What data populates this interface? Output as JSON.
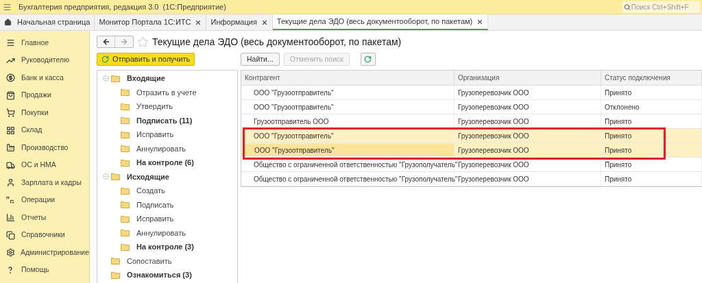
{
  "app_title": "Бухгалтерия предприятия, редакция 3.0  (1С:Предприятие)",
  "search": {
    "placeholder": "Поиск Ctrl+Shift+F"
  },
  "tabs": [
    {
      "label": "Начальная страница",
      "kind": "home",
      "selected": false
    },
    {
      "label": "Монитор Портала 1С:ИТС",
      "kind": "doc",
      "selected": false
    },
    {
      "label": "Информация",
      "kind": "doc",
      "selected": false
    },
    {
      "label": "Текущие дела ЭДО (весь документооборот, по пакетам)",
      "kind": "doc",
      "selected": true
    }
  ],
  "sidebar": {
    "items": [
      {
        "label": "Главное",
        "kind": "menu"
      },
      {
        "label": "Руководителю",
        "kind": "trend"
      },
      {
        "label": "Банк и касса",
        "kind": "bank"
      },
      {
        "label": "Продажи",
        "kind": "bag"
      },
      {
        "label": "Покупки",
        "kind": "cart"
      },
      {
        "label": "Склад",
        "kind": "grid"
      },
      {
        "label": "Производство",
        "kind": "factory"
      },
      {
        "label": "ОС и НМА",
        "kind": "truck"
      },
      {
        "label": "Зарплата и кадры",
        "kind": "person"
      },
      {
        "label": "Операции",
        "kind": "dtkt"
      },
      {
        "label": "Отчеты",
        "kind": "chart"
      },
      {
        "label": "Справочники",
        "kind": "books"
      },
      {
        "label": "Администрирование",
        "kind": "gear"
      },
      {
        "label": "Помощь",
        "kind": "help"
      }
    ]
  },
  "form": {
    "title": "Текущие дела ЭДО (весь документооборот, по пакетам)",
    "favorite": false,
    "send_button": "Отправить и получить",
    "find_button": "Найти...",
    "cancel_search_button": {
      "label": "Отменить поиск",
      "disabled": true
    }
  },
  "tree": [
    {
      "label": "Входящие",
      "bold": true,
      "expanded": true,
      "children": [
        {
          "label": "Отразить в учете",
          "bold": false
        },
        {
          "label": "Утвердить",
          "bold": false
        },
        {
          "label": "Подписать (11)",
          "bold": true
        },
        {
          "label": "Исправить",
          "bold": false
        },
        {
          "label": "Аннулировать",
          "bold": false
        },
        {
          "label": "На контроле (6)",
          "bold": true
        }
      ]
    },
    {
      "label": "Исходящие",
      "bold": true,
      "expanded": true,
      "children": [
        {
          "label": "Создать",
          "bold": false
        },
        {
          "label": "Подписать",
          "bold": false
        },
        {
          "label": "Исправить",
          "bold": false
        },
        {
          "label": "Аннулировать",
          "bold": false
        },
        {
          "label": "На контроле (3)",
          "bold": true
        }
      ]
    },
    {
      "label": "Сопоставить",
      "bold": false
    },
    {
      "label": "Ознакомиться (3)",
      "bold": true
    }
  ],
  "table": {
    "columns": [
      "Контрагент",
      "Организация",
      "Статус подключения"
    ],
    "rows": [
      {
        "cells": [
          "ООО \"Грузоотправитель\"",
          "Грузоперевозчик ООО",
          "Принято"
        ],
        "selected": false,
        "focused": false,
        "highlighted": false
      },
      {
        "cells": [
          "ООО \"Грузоотправитель\"",
          "Грузоперевозчик ООО",
          "Отклонено"
        ],
        "selected": false,
        "focused": false,
        "highlighted": false
      },
      {
        "cells": [
          "Грузоотправитель ООО",
          "Грузоперевозчик ООО",
          "Принято"
        ],
        "selected": false,
        "focused": false,
        "highlighted": false
      },
      {
        "cells": [
          "ООО \"Грузоотправитель\"",
          "Грузоперевозчик ООО",
          "Принято"
        ],
        "selected": true,
        "focused": false,
        "highlighted": true
      },
      {
        "cells": [
          "ООО \"Грузоотправитель\"",
          "Грузоперевозчик ООО",
          "Принято"
        ],
        "selected": true,
        "focused": true,
        "highlighted": true
      },
      {
        "cells": [
          "Общество с ограниченной ответственностью \"Грузополучатель\"",
          "Грузоперевозчик ООО",
          "Принято"
        ],
        "selected": false,
        "focused": false,
        "highlighted": false
      },
      {
        "cells": [
          "Общество с ограниченной ответственностью \"Грузополучатель\"",
          "Грузоперевозчик ООО",
          "Принято"
        ],
        "selected": false,
        "focused": false,
        "highlighted": false
      }
    ]
  }
}
